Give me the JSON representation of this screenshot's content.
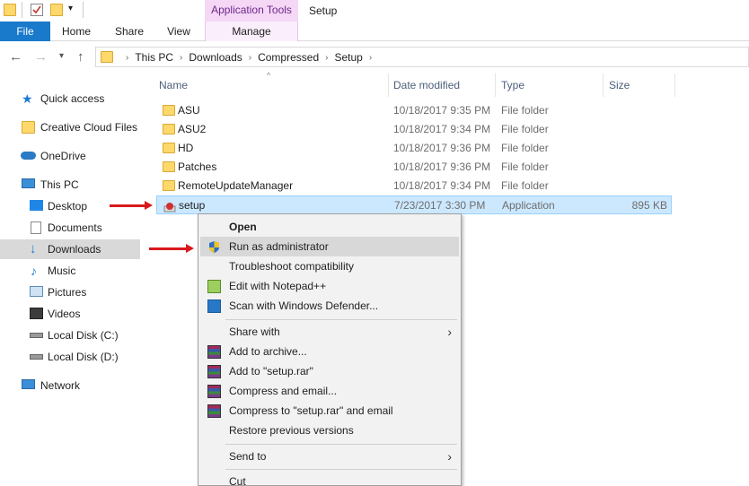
{
  "titlebar": {
    "app_tools_label": "Application Tools",
    "window_title": "Setup"
  },
  "ribbon": {
    "tabs": [
      "File",
      "Home",
      "Share",
      "View",
      "Manage"
    ]
  },
  "address": {
    "crumbs": [
      "This PC",
      "Downloads",
      "Compressed",
      "Setup"
    ]
  },
  "sidebar": {
    "items": [
      {
        "label": "Quick access",
        "icon": "star-icon"
      },
      {
        "label": "Creative Cloud Files",
        "icon": "creative-cloud-icon"
      },
      {
        "label": "OneDrive",
        "icon": "onedrive-icon"
      },
      {
        "label": "This PC",
        "icon": "computer-icon"
      },
      {
        "label": "Desktop",
        "icon": "desktop-icon"
      },
      {
        "label": "Documents",
        "icon": "documents-icon"
      },
      {
        "label": "Downloads",
        "icon": "downloads-icon"
      },
      {
        "label": "Music",
        "icon": "music-icon"
      },
      {
        "label": "Pictures",
        "icon": "pictures-icon"
      },
      {
        "label": "Videos",
        "icon": "videos-icon"
      },
      {
        "label": "Local Disk (C:)",
        "icon": "drive-icon"
      },
      {
        "label": "Local Disk (D:)",
        "icon": "drive-icon"
      },
      {
        "label": "Network",
        "icon": "network-icon"
      }
    ]
  },
  "columns": {
    "name": "Name",
    "date": "Date modified",
    "type": "Type",
    "size": "Size"
  },
  "files": [
    {
      "name": "ASU",
      "date": "10/18/2017 9:35 PM",
      "type": "File folder",
      "size": ""
    },
    {
      "name": "ASU2",
      "date": "10/18/2017 9:34 PM",
      "type": "File folder",
      "size": ""
    },
    {
      "name": "HD",
      "date": "10/18/2017 9:36 PM",
      "type": "File folder",
      "size": ""
    },
    {
      "name": "Patches",
      "date": "10/18/2017 9:36 PM",
      "type": "File folder",
      "size": ""
    },
    {
      "name": "RemoteUpdateManager",
      "date": "10/18/2017 9:34 PM",
      "type": "File folder",
      "size": ""
    },
    {
      "name": "setup",
      "date": "7/23/2017 3:30 PM",
      "type": "Application",
      "size": "895 KB"
    }
  ],
  "context_menu": {
    "items": [
      {
        "label": "Open",
        "icon": ""
      },
      {
        "label": "Run as administrator",
        "icon": "uac-shield-icon"
      },
      {
        "label": "Troubleshoot compatibility",
        "icon": ""
      },
      {
        "label": "Edit with Notepad++",
        "icon": "notepadpp-icon"
      },
      {
        "label": "Scan with Windows Defender...",
        "icon": "defender-icon"
      },
      {
        "label": "Share with",
        "icon": ""
      },
      {
        "label": "Add to archive...",
        "icon": "winrar-icon"
      },
      {
        "label": "Add to \"setup.rar\"",
        "icon": "winrar-icon"
      },
      {
        "label": "Compress and email...",
        "icon": "winrar-icon"
      },
      {
        "label": "Compress to \"setup.rar\" and email",
        "icon": "winrar-icon"
      },
      {
        "label": "Restore previous versions",
        "icon": ""
      },
      {
        "label": "Send to",
        "icon": ""
      },
      {
        "label": "Cut",
        "icon": ""
      }
    ]
  },
  "colors": {
    "file_tab": "#1979ca",
    "app_tools": "#f5d7f6",
    "selection": "#cce8ff",
    "annotation_arrow": "#d9191c"
  }
}
